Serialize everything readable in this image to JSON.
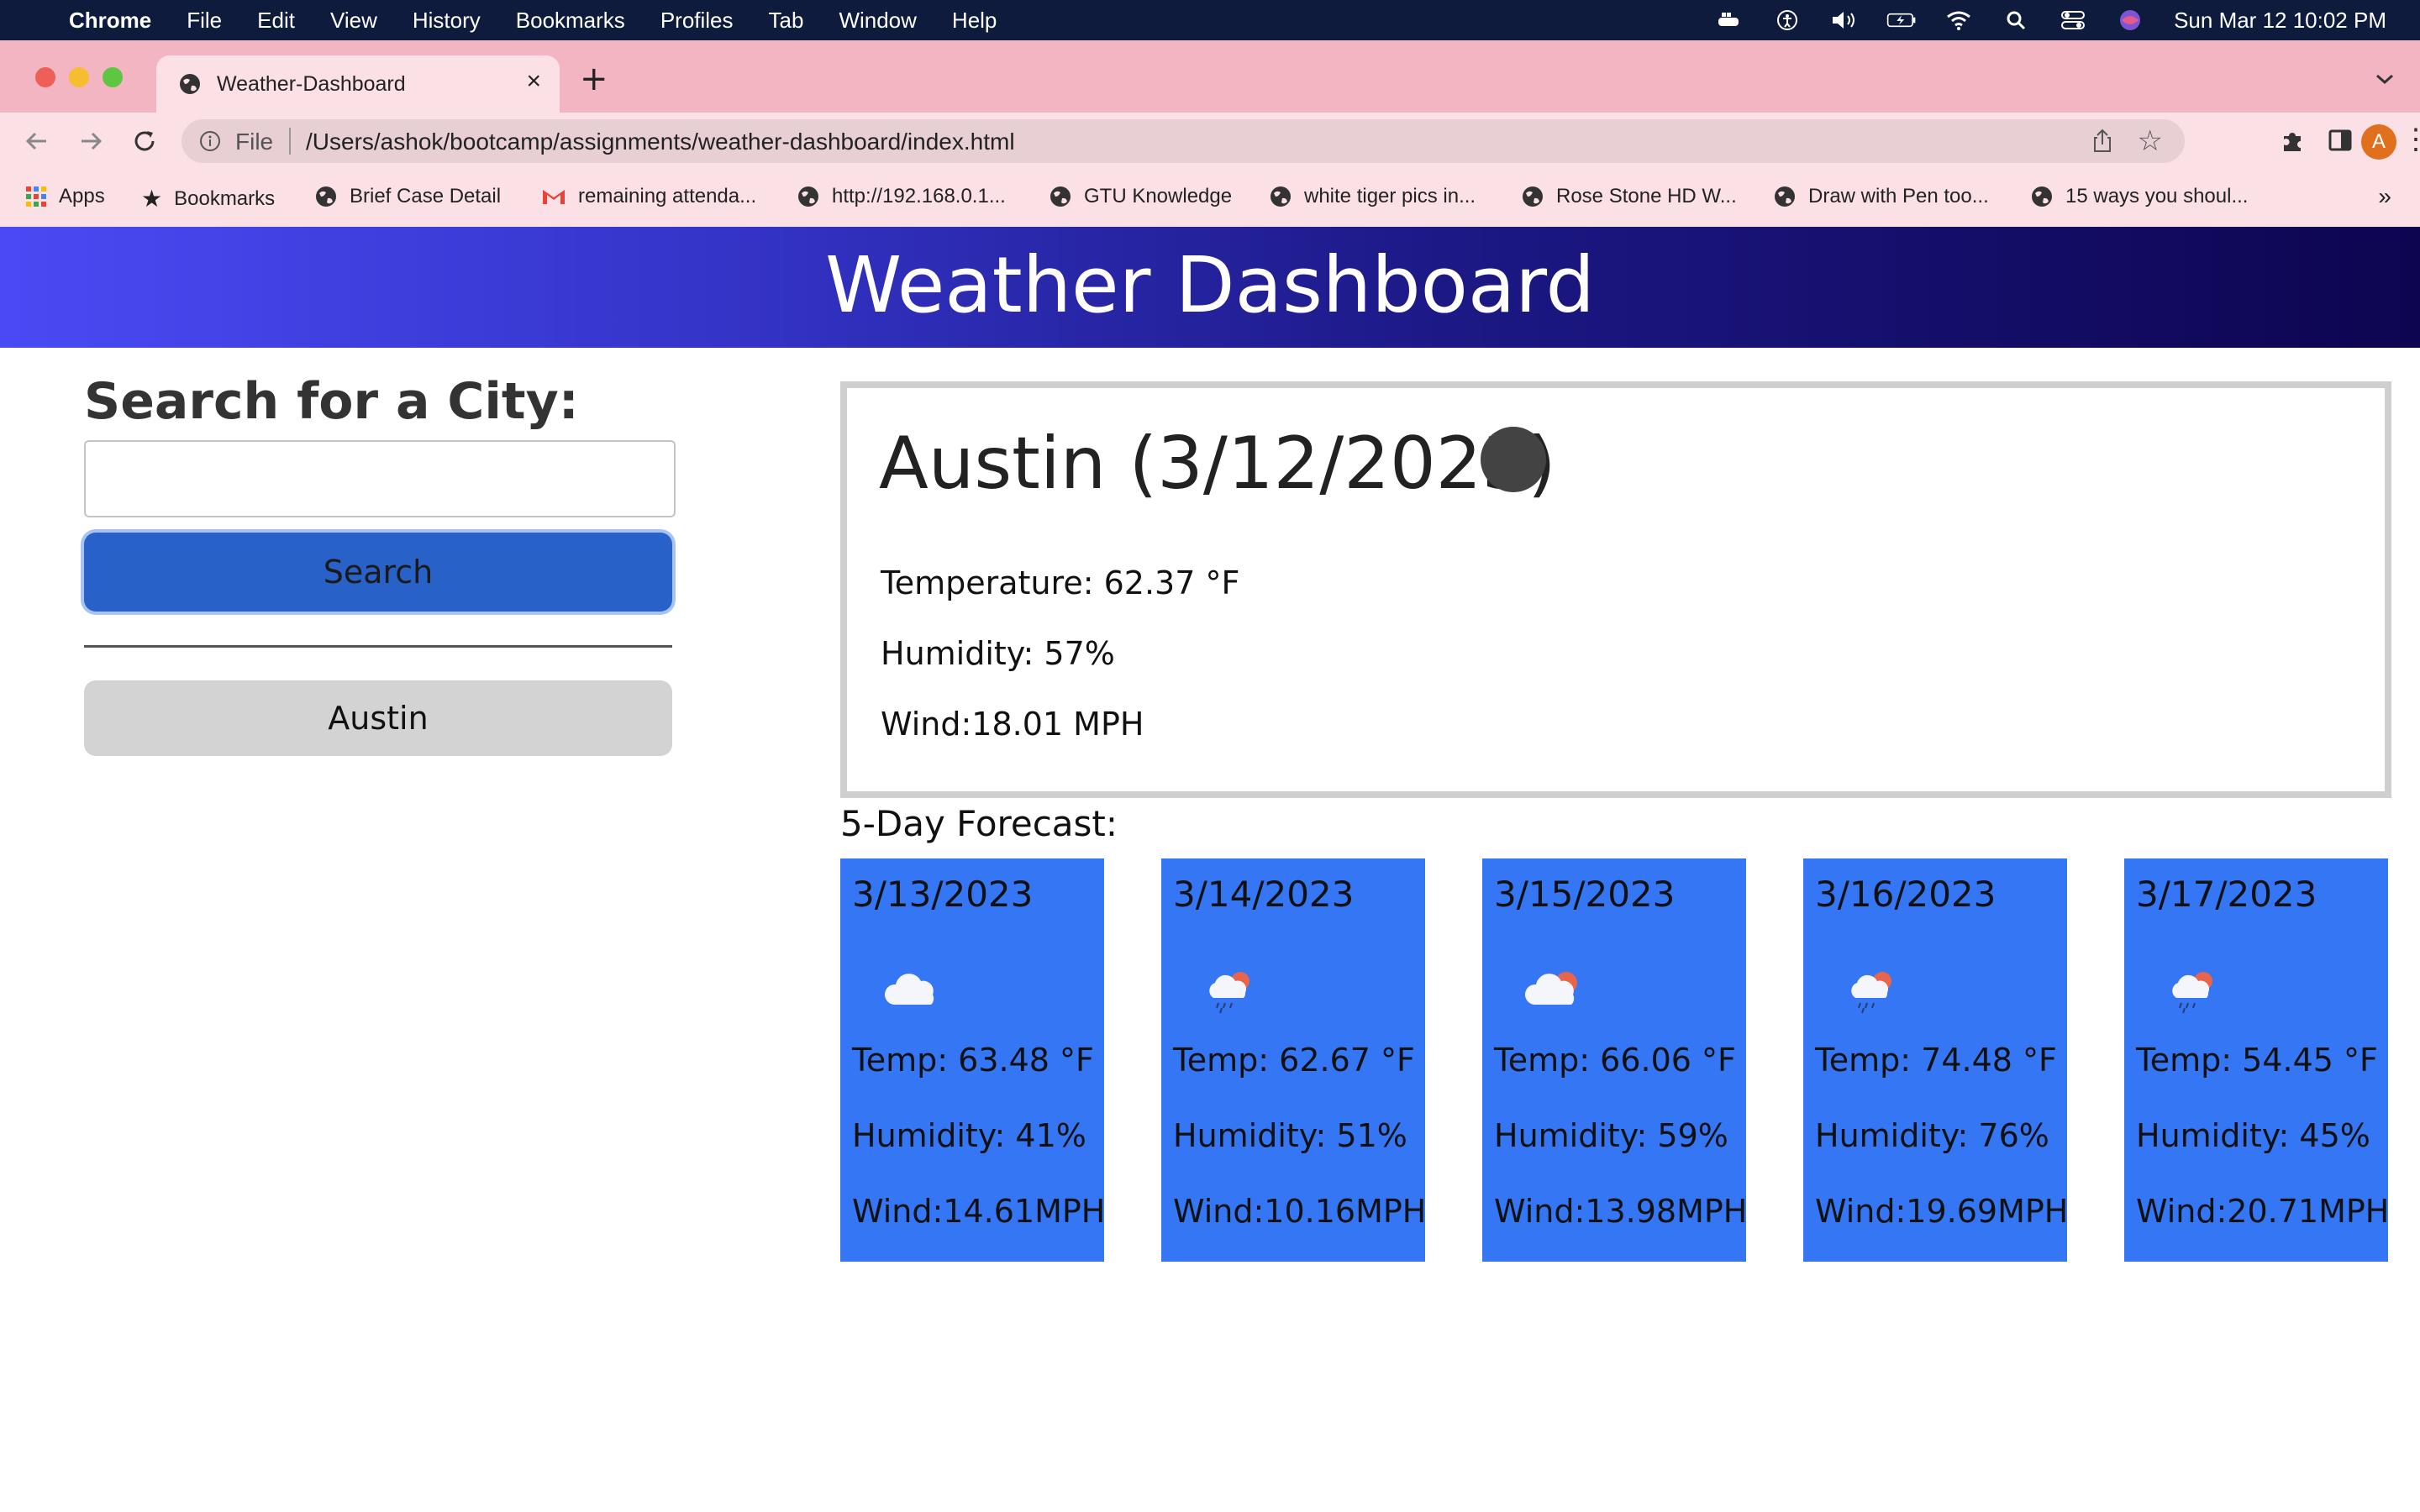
{
  "menubar": {
    "app": "Chrome",
    "items": [
      "File",
      "Edit",
      "View",
      "History",
      "Bookmarks",
      "Profiles",
      "Tab",
      "Window",
      "Help"
    ],
    "clock": "Sun Mar 12  10:02 PM"
  },
  "browser": {
    "tab_title": "Weather-Dashboard",
    "url_scheme": "File",
    "url": "/Users/ashok/bootcamp/assignments/weather-dashboard/index.html",
    "avatar_letter": "A",
    "bookmarks": [
      "Apps",
      "Bookmarks",
      "Brief Case Detail",
      "remaining attenda...",
      "http://192.168.0.1...",
      "GTU Knowledge",
      "white tiger pics in...",
      "Rose Stone HD W...",
      "Draw with Pen too...",
      "15 ways you shoul..."
    ],
    "bookmarks_more": "»"
  },
  "page": {
    "header_title": "Weather Dashboard",
    "search_heading": "Search for a City:",
    "search_value": "",
    "search_button": "Search",
    "history": [
      "Austin"
    ],
    "current": {
      "city_date": "Austin (3/12/2023)",
      "temperature": "Temperature: 62.37 °F",
      "humidity": "Humidity: 57%",
      "wind": "Wind:18.01 MPH"
    },
    "forecast_title": "5-Day Forecast:",
    "forecast": [
      {
        "date": "3/13/2023",
        "icon": "cloud-icon",
        "temp": "Temp: 63.48 °F",
        "humidity": "Humidity: 41%",
        "wind": "Wind:14.61MPH"
      },
      {
        "date": "3/14/2023",
        "icon": "rain-sun-icon",
        "temp": "Temp: 62.67 °F",
        "humidity": "Humidity: 51%",
        "wind": "Wind:10.16MPH"
      },
      {
        "date": "3/15/2023",
        "icon": "cloud-sun-icon",
        "temp": "Temp: 66.06 °F",
        "humidity": "Humidity: 59%",
        "wind": "Wind:13.98MPH"
      },
      {
        "date": "3/16/2023",
        "icon": "rain-sun-icon",
        "temp": "Temp: 74.48 °F",
        "humidity": "Humidity: 76%",
        "wind": "Wind:19.69MPH"
      },
      {
        "date": "3/17/2023",
        "icon": "rain-sun-icon",
        "temp": "Temp: 54.45 °F",
        "humidity": "Humidity: 45%",
        "wind": "Wind:20.71MPH"
      }
    ]
  },
  "colors": {
    "header_gradient_start": "#4a4af5",
    "header_gradient_end": "#0d0550",
    "search_button": "#2862c9",
    "forecast_card": "#3476f3",
    "tab_strip": "#f3b5c1"
  }
}
